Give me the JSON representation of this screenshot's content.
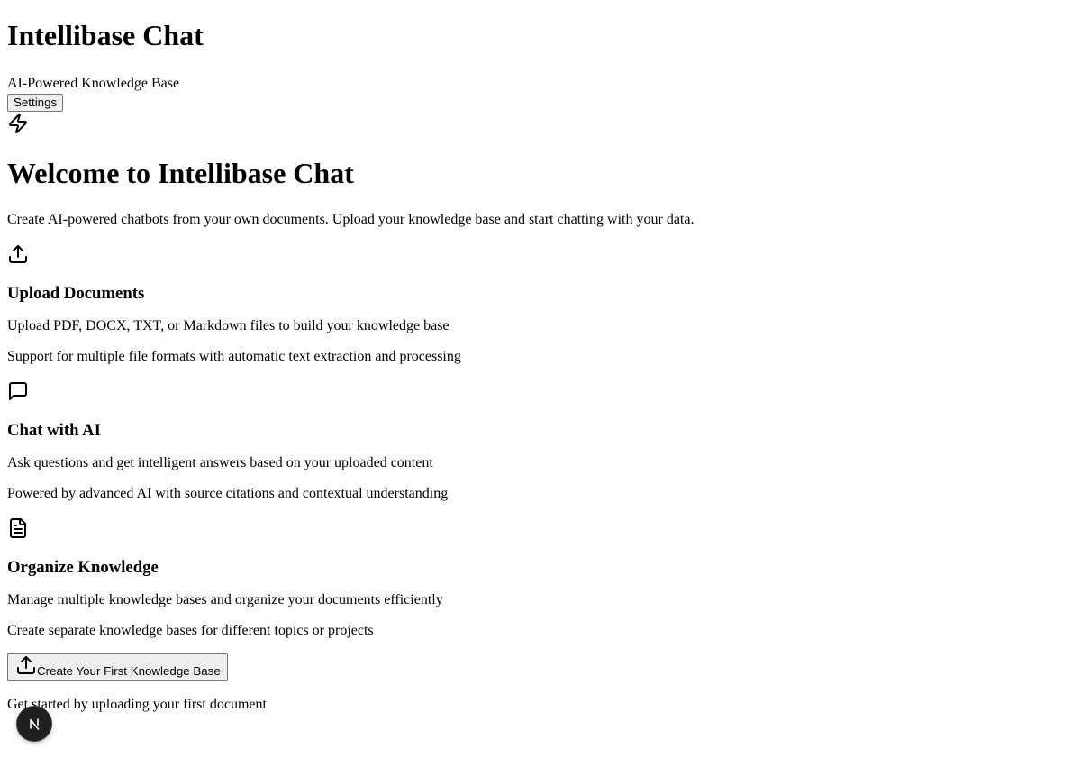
{
  "header": {
    "title": "Intellibase Chat",
    "subtitle": "AI-Powered Knowledge Base",
    "settings_label": "Settings"
  },
  "hero": {
    "icon": "zap-icon",
    "title": "Welcome to Intellibase Chat",
    "description": "Create AI-powered chatbots from your own documents. Upload your knowledge base and start chatting with your data."
  },
  "features": [
    {
      "icon": "upload-icon",
      "title": "Upload Documents",
      "description": "Upload PDF, DOCX, TXT, or Markdown files to build your knowledge base",
      "detail": "Support for multiple file formats with automatic text extraction and processing"
    },
    {
      "icon": "message-square-icon",
      "title": "Chat with AI",
      "description": "Ask questions and get intelligent answers based on your uploaded content",
      "detail": "Powered by advanced AI with source citations and contextual understanding"
    },
    {
      "icon": "file-text-icon",
      "title": "Organize Knowledge",
      "description": "Manage multiple knowledge bases and organize your documents efficiently",
      "detail": "Create separate knowledge bases for different topics or projects"
    }
  ],
  "cta": {
    "icon": "upload-icon",
    "label": "Create Your First Knowledge Base",
    "note": "Get started by uploading your first document"
  },
  "dev_badge": {
    "icon": "nextjs-logo-icon",
    "text": "N"
  }
}
